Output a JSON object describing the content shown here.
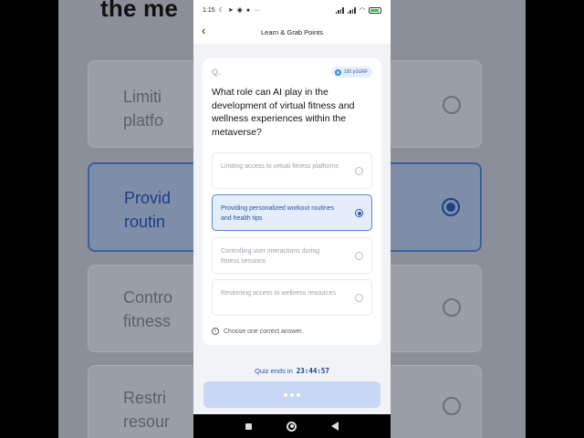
{
  "status_bar": {
    "time": "1:15",
    "left_icons": [
      "moon-icon",
      "telegram-icon",
      "vpn-icon",
      "chat-icon"
    ],
    "more": "···",
    "battery_percent": "76"
  },
  "app_bar": {
    "title": "Learn & Grab Points"
  },
  "quiz": {
    "question_label": "Q.",
    "reward": "100 pSURF",
    "question": "What role can AI play in the development of virtual fitness and wellness experiences within the metaverse?",
    "options": [
      {
        "label": "Limiting access to virtual fitness platforms",
        "selected": false
      },
      {
        "label": "Providing personalized workout routines and health tips",
        "selected": true
      },
      {
        "label": "Controlling user interactions during fitness sessions",
        "selected": false
      },
      {
        "label": "Restricting access to wellness resources",
        "selected": false
      }
    ],
    "hint": "Choose one correct answer."
  },
  "timer": {
    "label": "Quiz ends in",
    "value": "23:44:57"
  },
  "backdrop": {
    "title": "the me",
    "options": [
      "Limiti",
      "platfo",
      "Provid",
      "routin",
      "Contro",
      "fitness",
      "Restri",
      "resour"
    ]
  },
  "colors": {
    "accent": "#2c56a8",
    "selected_bg": "#e4eefb",
    "submit_disabled": "#c7d7f4"
  }
}
